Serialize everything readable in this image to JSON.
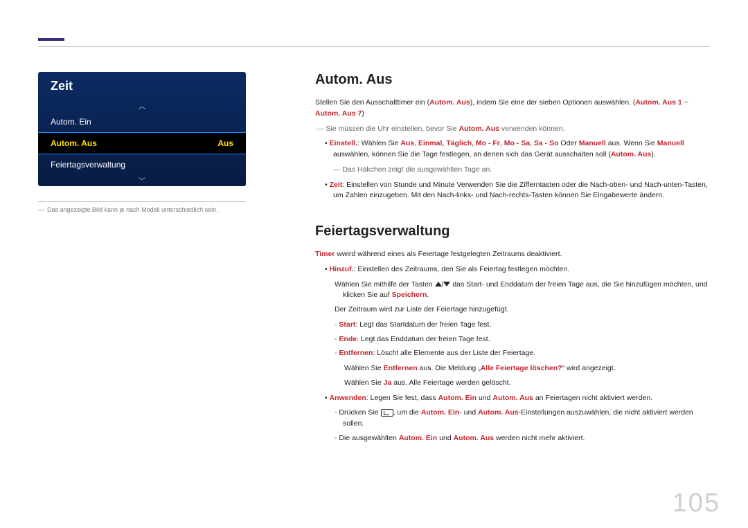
{
  "page_number": "105",
  "osd": {
    "title": "Zeit",
    "row_autom_ein": "Autom. Ein",
    "row_autom_aus_label": "Autom. Aus",
    "row_autom_aus_value": "Aus",
    "row_feiertag": "Feiertagsverwaltung"
  },
  "left_note": "Das angezeigte Bild kann je nach Modell unterschiedlich sein.",
  "section1": {
    "heading": "Autom. Aus",
    "p1_a": "Stellen Sie den Ausschalttimer ein (",
    "p1_b": "Autom. Aus",
    "p1_c": "), indem Sie eine der sieben Optionen auswählen. (",
    "p1_d": "Autom. Aus 1",
    "p1_e": " ~ ",
    "p1_f": "Autom. Aus 7",
    "p1_g": ")",
    "dash1_a": "Sie müssen die Uhr einstellen, bevor Sie ",
    "dash1_b": "Autom. Aus",
    "dash1_c": " verwenden können.",
    "bul1_label": "Einstell.",
    "bul1_a": ": Wählen Sie ",
    "bul1_opts": [
      "Aus",
      "Einmal",
      "Täglich",
      "Mo - Fr",
      "Mo - Sa",
      "Sa - So"
    ],
    "bul1_sep": ", ",
    "bul1_b": " Oder ",
    "bul1_manual": "Manuell",
    "bul1_c": " aus. Wenn Sie ",
    "bul1_d": " auswählen, können Sie die Tage festlegen, an denen sich das Gerät ausschalten soll (",
    "bul1_e": "Autom. Aus",
    "bul1_f": ").",
    "dash2": "Das Häkchen zeigt die ausgewählten Tage an.",
    "bul2_label": "Zeit",
    "bul2_text": ": Einstellen von Stunde und Minute Verwenden Sie die Zifferntasten oder die Nach-oben- und Nach-unten-Tasten, um Zahlen einzugeben. Mit den Nach-links- und Nach-rechts-Tasten können Sie Eingabewerte ändern."
  },
  "section2": {
    "heading": "Feiertagsverwaltung",
    "p1_a": "Timer",
    "p1_b": " wwird während eines als Feiertage festgelegten Zeitraums deaktiviert.",
    "bul1_label": "Hinzuf.",
    "bul1_text": ": Einstellen des Zeitraums, den Sie als Feiertag festlegen möchten.",
    "bul1_line2_a": "Wählen Sie mithilfe der Tasten ",
    "bul1_line2_b": " das Start- und Enddatum der freien Tage aus, die Sie hinzufügen möchten, und klicken Sie auf ",
    "bul1_line2_c": "Speichern",
    "bul1_line2_d": ".",
    "bul1_line3": "Der Zeitraum wird zur Liste der Feiertage hinzugefügt.",
    "dash_start_a": "Start",
    "dash_start_b": ": Legt das Startdatum der freien Tage fest.",
    "dash_ende_a": "Ende",
    "dash_ende_b": ": Legt das Enddatum der freien Tage fest.",
    "dash_entf_a": "Entfernen",
    "dash_entf_b": ": Löscht alle Elemente aus der Liste der Feiertage.",
    "entf_line2_a": "Wählen Sie ",
    "entf_line2_b": "Entfernen",
    "entf_line2_c": " aus. Die Meldung „",
    "entf_line2_d": "Alle Feiertage löschen?",
    "entf_line2_e": "“ wird angezeigt.",
    "entf_line3_a": "Wählen Sie ",
    "entf_line3_b": "Ja",
    "entf_line3_c": " aus. Alle Feiertage werden gelöscht.",
    "bul2_label": "Anwenden",
    "bul2_a": ": Legen Sie fest, dass ",
    "bul2_b": "Autom. Ein",
    "bul2_c": " und ",
    "bul2_d": "Autom. Aus",
    "bul2_e": " an Feiertagen nicht aktiviert werden.",
    "dash_apply1_a": "Drücken Sie ",
    "dash_apply1_b": ", um die ",
    "dash_apply1_c": "Autom. Ein",
    "dash_apply1_d": "- und ",
    "dash_apply1_e": "Autom. Aus",
    "dash_apply1_f": "-Einstellungen auszuwählen, die nicht aktiviert werden sollen.",
    "dash_apply2_a": "Die ausgewählten ",
    "dash_apply2_b": "Autom. Ein",
    "dash_apply2_c": " und ",
    "dash_apply2_d": "Autom. Aus",
    "dash_apply2_e": " werden nicht mehr aktiviert."
  }
}
